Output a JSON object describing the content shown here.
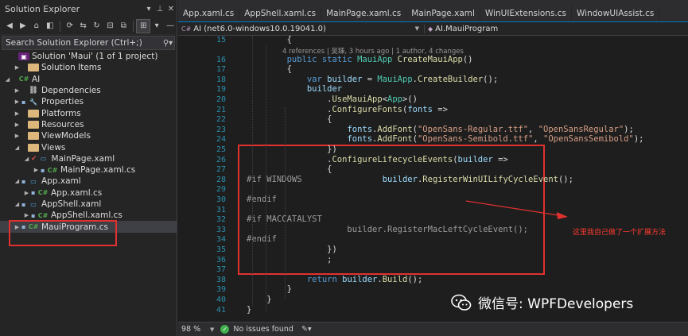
{
  "solution_explorer": {
    "title": "Solution Explorer",
    "search_placeholder": "Search Solution Explorer (Ctrl+;)",
    "tree": [
      {
        "label": "Solution 'Maui' (1 of 1 project)",
        "icon": "solution-icon",
        "indent": 0,
        "arrow": "",
        "lock": false
      },
      {
        "label": "Solution Items",
        "icon": "folder-icon",
        "indent": 1,
        "arrow": "▶",
        "lock": false
      },
      {
        "label": "AI",
        "icon": "csproj-icon",
        "indent": 0,
        "arrow": "◢",
        "lock": false
      },
      {
        "label": "Dependencies",
        "icon": "dependencies-icon",
        "indent": 1,
        "arrow": "▶",
        "lock": false
      },
      {
        "label": "Properties",
        "icon": "properties-icon",
        "indent": 1,
        "arrow": "▶",
        "lock": true
      },
      {
        "label": "Platforms",
        "icon": "folder-icon",
        "indent": 1,
        "arrow": "▶",
        "lock": false
      },
      {
        "label": "Resources",
        "icon": "folder-icon",
        "indent": 1,
        "arrow": "▶",
        "lock": false
      },
      {
        "label": "ViewModels",
        "icon": "folder-icon",
        "indent": 1,
        "arrow": "▶",
        "lock": false
      },
      {
        "label": "Views",
        "icon": "folder-icon",
        "indent": 1,
        "arrow": "◢",
        "lock": false
      },
      {
        "label": "MainPage.xaml",
        "icon": "xaml-icon",
        "indent": 2,
        "arrow": "◢",
        "lock": false,
        "check": true
      },
      {
        "label": "MainPage.xaml.cs",
        "icon": "cs-icon",
        "indent": 3,
        "arrow": "▶",
        "lock": true
      },
      {
        "label": "App.xaml",
        "icon": "xaml-icon",
        "indent": 1,
        "arrow": "◢",
        "lock": true
      },
      {
        "label": "App.xaml.cs",
        "icon": "cs-icon",
        "indent": 2,
        "arrow": "▶",
        "lock": true
      },
      {
        "label": "AppShell.xaml",
        "icon": "xaml-icon",
        "indent": 1,
        "arrow": "◢",
        "lock": true
      },
      {
        "label": "AppShell.xaml.cs",
        "icon": "cs-icon",
        "indent": 2,
        "arrow": "▶",
        "lock": true
      },
      {
        "label": "MauiProgram.cs",
        "icon": "cs-icon",
        "indent": 1,
        "arrow": "▶",
        "lock": true,
        "selected": true
      }
    ]
  },
  "editor": {
    "tabs": [
      "App.xaml.cs",
      "AppShell.xaml.cs",
      "MainPage.xaml.cs",
      "MainPage.xaml",
      "WinUIExtensions.cs",
      "WindowUIAssist.cs"
    ],
    "project_dropdown": "AI (net6.0-windows10.0.19041.0)",
    "member_dropdown": "AI.MauiProgram",
    "codelens": "4 references | 吴臻, 3 hours ago | 1 author, 4 changes",
    "code_lines": [
      {
        "n": "15",
        "segs": [
          {
            "t": "        {",
            "c": "pl"
          }
        ]
      },
      {
        "n": "16",
        "segs": [
          {
            "t": "        ",
            "c": "pl"
          },
          {
            "t": "public static ",
            "c": "kw"
          },
          {
            "t": "MauiApp ",
            "c": "ty"
          },
          {
            "t": "CreateMauiApp",
            "c": "mt"
          },
          {
            "t": "()",
            "c": "pl"
          }
        ]
      },
      {
        "n": "17",
        "segs": [
          {
            "t": "        {",
            "c": "pl"
          }
        ]
      },
      {
        "n": "18",
        "segs": [
          {
            "t": "            ",
            "c": "pl"
          },
          {
            "t": "var ",
            "c": "kw"
          },
          {
            "t": "builder ",
            "c": "vr"
          },
          {
            "t": "= ",
            "c": "pl"
          },
          {
            "t": "MauiApp",
            "c": "ty"
          },
          {
            "t": ".",
            "c": "pl"
          },
          {
            "t": "CreateBuilder",
            "c": "mt"
          },
          {
            "t": "();",
            "c": "pl"
          }
        ]
      },
      {
        "n": "19",
        "segs": [
          {
            "t": "            ",
            "c": "pl"
          },
          {
            "t": "builder",
            "c": "vr"
          }
        ]
      },
      {
        "n": "20",
        "segs": [
          {
            "t": "                .",
            "c": "pl"
          },
          {
            "t": "UseMauiApp",
            "c": "mt"
          },
          {
            "t": "<",
            "c": "pl"
          },
          {
            "t": "App",
            "c": "ty"
          },
          {
            "t": ">()",
            "c": "pl"
          }
        ]
      },
      {
        "n": "21",
        "segs": [
          {
            "t": "                .",
            "c": "pl"
          },
          {
            "t": "ConfigureFonts",
            "c": "mt"
          },
          {
            "t": "(",
            "c": "pl"
          },
          {
            "t": "fonts ",
            "c": "vr"
          },
          {
            "t": "=>",
            "c": "pl"
          }
        ]
      },
      {
        "n": "22",
        "segs": [
          {
            "t": "                {",
            "c": "pl"
          }
        ]
      },
      {
        "n": "23",
        "segs": [
          {
            "t": "                    ",
            "c": "pl"
          },
          {
            "t": "fonts",
            "c": "vr"
          },
          {
            "t": ".",
            "c": "pl"
          },
          {
            "t": "AddFont",
            "c": "mt"
          },
          {
            "t": "(",
            "c": "pl"
          },
          {
            "t": "\"OpenSans-Regular.ttf\"",
            "c": "st"
          },
          {
            "t": ", ",
            "c": "pl"
          },
          {
            "t": "\"OpenSansRegular\"",
            "c": "st"
          },
          {
            "t": ");",
            "c": "pl"
          }
        ]
      },
      {
        "n": "24",
        "segs": [
          {
            "t": "                    ",
            "c": "pl"
          },
          {
            "t": "fonts",
            "c": "vr"
          },
          {
            "t": ".",
            "c": "pl"
          },
          {
            "t": "AddFont",
            "c": "mt"
          },
          {
            "t": "(",
            "c": "pl"
          },
          {
            "t": "\"OpenSans-Semibold.ttf\"",
            "c": "st"
          },
          {
            "t": ", ",
            "c": "pl"
          },
          {
            "t": "\"OpenSansSemibold\"",
            "c": "st"
          },
          {
            "t": ");",
            "c": "pl"
          }
        ]
      },
      {
        "n": "25",
        "segs": [
          {
            "t": "                })",
            "c": "pl"
          }
        ]
      },
      {
        "n": "26",
        "segs": [
          {
            "t": "                .",
            "c": "pl"
          },
          {
            "t": "ConfigureLifecycleEvents",
            "c": "mt"
          },
          {
            "t": "(",
            "c": "pl"
          },
          {
            "t": "builder ",
            "c": "vr"
          },
          {
            "t": "=>",
            "c": "pl"
          }
        ]
      },
      {
        "n": "27",
        "segs": [
          {
            "t": "                {",
            "c": "pl"
          }
        ]
      },
      {
        "n": "28",
        "segs": [
          {
            "t": "#if WINDOWS",
            "c": "pp"
          },
          {
            "t": "                ",
            "c": "pl"
          },
          {
            "t": "builder",
            "c": "vr"
          },
          {
            "t": ".",
            "c": "pl"
          },
          {
            "t": "RegisterWinUILifyCycleEvent",
            "c": "mt"
          },
          {
            "t": "();",
            "c": "pl"
          }
        ]
      },
      {
        "n": "29",
        "segs": [
          {
            "t": "",
            "c": "pl"
          }
        ]
      },
      {
        "n": "30",
        "segs": [
          {
            "t": "#endif",
            "c": "pp"
          }
        ]
      },
      {
        "n": "31",
        "segs": [
          {
            "t": "",
            "c": "pl"
          }
        ]
      },
      {
        "n": "32",
        "segs": [
          {
            "t": "#if MACCATALYST",
            "c": "pp"
          }
        ]
      },
      {
        "n": "33",
        "segs": [
          {
            "t": "                    builder.RegisterMacLeftCycleEvent();",
            "c": "gr"
          }
        ]
      },
      {
        "n": "34",
        "segs": [
          {
            "t": "#endif",
            "c": "pp"
          }
        ]
      },
      {
        "n": "35",
        "segs": [
          {
            "t": "                })",
            "c": "pl"
          }
        ]
      },
      {
        "n": "36",
        "segs": [
          {
            "t": "                ;",
            "c": "pl"
          }
        ]
      },
      {
        "n": "37",
        "segs": [
          {
            "t": "",
            "c": "pl"
          }
        ]
      },
      {
        "n": "38",
        "segs": [
          {
            "t": "            ",
            "c": "pl"
          },
          {
            "t": "return ",
            "c": "kw"
          },
          {
            "t": "builder",
            "c": "vr"
          },
          {
            "t": ".",
            "c": "pl"
          },
          {
            "t": "Build",
            "c": "mt"
          },
          {
            "t": "();",
            "c": "pl"
          }
        ]
      },
      {
        "n": "39",
        "segs": [
          {
            "t": "        }",
            "c": "pl"
          }
        ]
      },
      {
        "n": "40",
        "segs": [
          {
            "t": "    }",
            "c": "pl"
          }
        ]
      },
      {
        "n": "41",
        "segs": [
          {
            "t": "}",
            "c": "pl"
          }
        ]
      }
    ],
    "annotation": "这里我自己做了一个扩展方法",
    "watermark": "微信号: WPFDevelopers"
  },
  "status_bar": {
    "zoom": "98 %",
    "issues": "No issues found"
  },
  "colors": {
    "accent": "#007acc",
    "highlight_red": "#e0312f",
    "ok_green": "#3fae4c"
  }
}
